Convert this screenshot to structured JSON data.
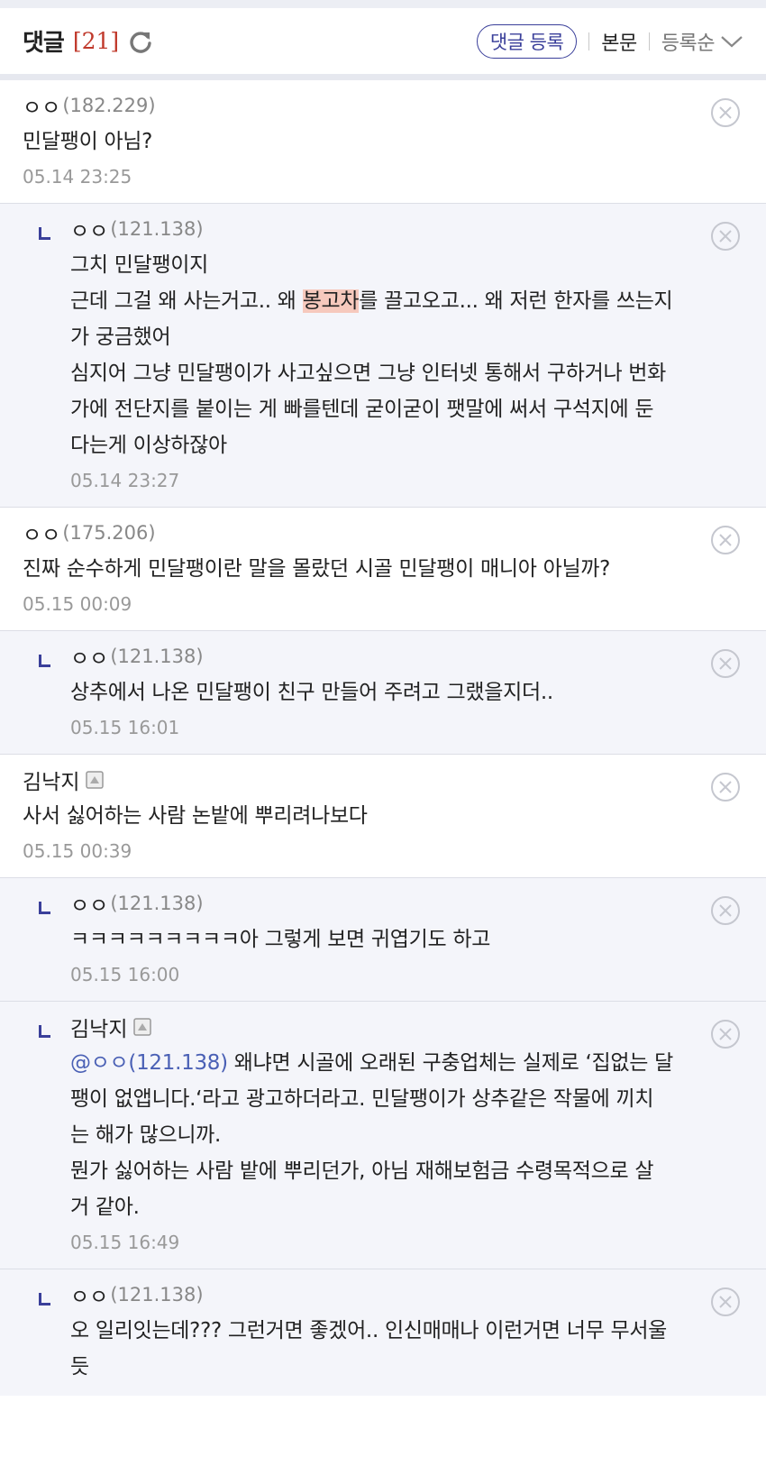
{
  "header": {
    "title": "댓글",
    "count": "[21]",
    "write_label": "댓글 등록",
    "body_label": "본문",
    "sort_label": "등록순"
  },
  "comments": [
    {
      "author": "ㅇㅇ",
      "ip": "(182.229)",
      "lines": [
        "민달팽이 아님?"
      ],
      "date": "05.14 23:25"
    },
    {
      "author": "ㅇㅇ",
      "ip": "(121.138)",
      "lines": [
        "그치 민달팽이지",
        "근데 그걸 왜 사는거고.. 왜 ",
        "가 궁금했어",
        "심지어 그냥 민달팽이가 사고싶으면 그냥 인터넷 통해서 구하거나 번화",
        "가에 전단지를 붙이는 게 빠를텐데 굳이굳이 팻말에 써서 구석지에 둔",
        "다는게 이상하잖아"
      ],
      "highlight": "봉고차",
      "after_highlight": "를 끌고오고... 왜 저런 한자를 쓰는지",
      "date": "05.14 23:27"
    },
    {
      "author": "ㅇㅇ",
      "ip": "(175.206)",
      "lines": [
        "진짜 순수하게 민달팽이란 말을 몰랐던 시골 민달팽이 매니아 아닐까?"
      ],
      "date": "05.15 00:09"
    },
    {
      "author": "ㅇㅇ",
      "ip": "(121.138)",
      "lines": [
        "상추에서 나온 민달팽이 친구 만들어 주려고 그랬을지더.."
      ],
      "date": "05.15 16:01"
    },
    {
      "author": "김낙지",
      "ip": "",
      "lines": [
        "사서 싫어하는 사람 논밭에 뿌리려나보다"
      ],
      "date": "05.15 00:39"
    },
    {
      "author": "ㅇㅇ",
      "ip": "(121.138)",
      "lines": [
        "ㅋㅋㅋㅋㅋㅋㅋㅋㅋ아 그렇게 보면 귀엽기도 하고"
      ],
      "date": "05.15 16:00"
    },
    {
      "author": "김낙지",
      "ip": "",
      "mention": "@ㅇㅇ(121.138)",
      "lines": [
        " 왜냐면 시골에 오래된 구충업체는 실제로 ‘집없는 달",
        "팽이 없앱니다.‘라고 광고하더라고. 민달팽이가 상추같은 작물에 끼치",
        "는 해가 많으니까.",
        "뭔가 싫어하는 사람 밭에 뿌리던가, 아님 재해보험금 수령목적으로 살",
        "거 같아."
      ],
      "date": "05.15 16:49"
    },
    {
      "author": "ㅇㅇ",
      "ip": "(121.138)",
      "lines": [
        "오 일리잇는데??? 그런거면 좋겠어.. 인신매매나 이런거면 너무 무서울",
        "듯"
      ],
      "date": ""
    }
  ],
  "colors": {
    "accent": "#3a3f9a",
    "count": "#c0392b",
    "highlight": "#f6c9bd",
    "mention": "#4a60b5"
  },
  "icons": {
    "refresh": "refresh-icon",
    "delete": "close-circle-icon",
    "sort": "chevron-down-icon",
    "member": "member-icon"
  }
}
